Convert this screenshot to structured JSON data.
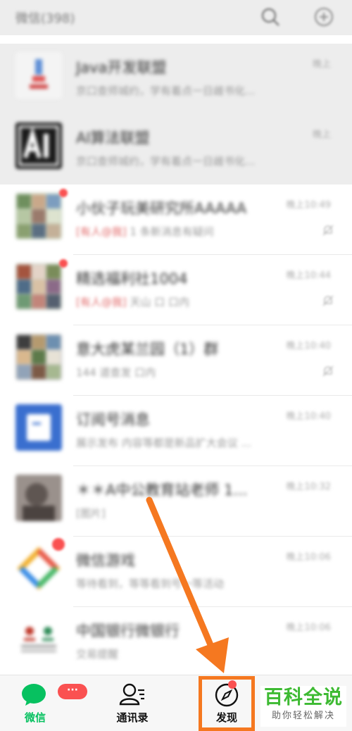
{
  "header": {
    "title": "微信(398)"
  },
  "chats": [
    {
      "name": "Java开发联盟",
      "preview": "京口查师城约，学有着点一日雌书化...",
      "time": "晚上",
      "mention": ""
    },
    {
      "name": "AI算法联盟",
      "preview": "京口查师城约，学有着点一日雌书化...",
      "time": "晚上",
      "mention": ""
    },
    {
      "name": "小伙子玩美研究所AAAAA",
      "preview": "1 条新消息有疑问",
      "time": "晚上10:49",
      "mention": "[有人@我]"
    },
    {
      "name": "精选福利社1004",
      "preview": "天山 口 口内",
      "time": "晚上10:44",
      "mention": "[有人@我]"
    },
    {
      "name": "意大虎某兰园（1）群",
      "preview": "144 道查发 口内",
      "time": "晚上10:40",
      "mention": ""
    },
    {
      "name": "订阅号消息",
      "preview": "展示发布 内容等都是新品扩大会议 ...",
      "time": "晚上10:40",
      "mention": ""
    },
    {
      "name": "＊＊A中公教育站老师 1...",
      "preview": "[图片]",
      "time": "晚上10:32",
      "mention": ""
    },
    {
      "name": "微信游戏",
      "preview": "等待看到，等等看到号一等活动",
      "time": "晚上10:06",
      "mention": ""
    },
    {
      "name": "中国银行微银行",
      "preview": "交易提醒",
      "time": "晚上10:06",
      "mention": ""
    }
  ],
  "tabs": [
    {
      "label": "微信",
      "badge": "···"
    },
    {
      "label": "通讯录"
    },
    {
      "label": "发现"
    }
  ],
  "watermark": {
    "title": "百科全说",
    "subtitle": "助你轻松解决"
  },
  "colors": {
    "wechat_green": "#07c160",
    "badge_red": "#fa5151",
    "highlight_orange": "#f57820",
    "watermark_green": "#3dba32"
  }
}
